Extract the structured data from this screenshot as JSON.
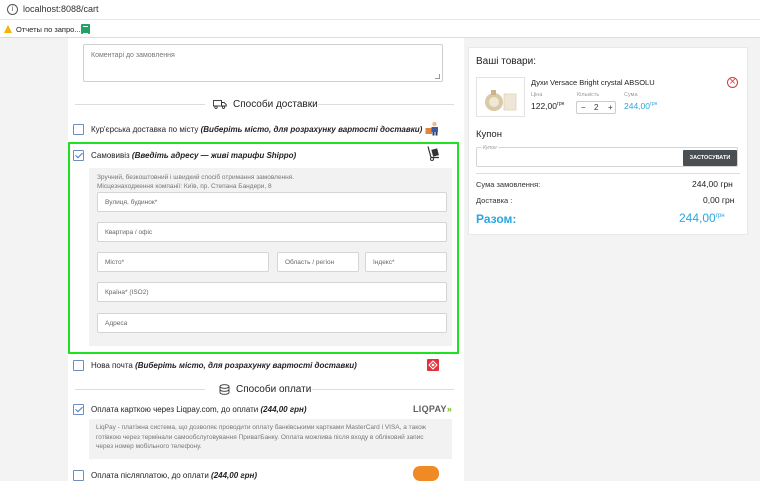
{
  "browser": {
    "url": "localhost:8088/cart",
    "bookmark1": "Отчеты по запро..."
  },
  "comment": {
    "placeholder": "Коментарі до замовлення"
  },
  "delivery": {
    "title": "Способи доставки",
    "courier_label": "Кур'єрська доставка по місту",
    "courier_hint": "(Виберіть місто, для розрахунку вартості доставки)",
    "pickup_label": "Самовивіз",
    "pickup_hint": "(Введіть адресу — живі тарифи Shippo)",
    "pickup_desc1": "Зручний, безкоштовний і швидкий спосіб отримання замовлення.",
    "pickup_desc2": "Місцезнаходження компанії: Київ, пр. Степана Бандери, 8",
    "fields": {
      "street": "Вулиця, будинок*",
      "apartment": "Квартира / офіс",
      "city": "Місто*",
      "region": "Область / регіон",
      "zip": "Індекс*",
      "country": "Країна* (ISO2)",
      "address": "Адреса"
    },
    "novaposhta_label": "Нова почта",
    "novaposhta_hint": "(Виберіть місто, для розрахунку вартості доставки)"
  },
  "payment": {
    "title": "Способи оплати",
    "liqpay_label": "Оплата карткою через Liqpay.com, до оплати",
    "liqpay_amount": "(244,00 грн)",
    "liqpay_logo": "LIQPAY",
    "liqpay_desc1": "LiqPay - платіжна система, що дозволяє проводити оплату банківськими картками MasterCard і VISA, а також",
    "liqpay_desc2": "готівкою через термінали самообслуговування ПриватБанку. Оплата можлива після входу в обліковий запис",
    "liqpay_desc3": "через номер мобільного телефону.",
    "cod_label": "Оплата післяплатою, до оплати",
    "cod_amount": "(244,00 грн)"
  },
  "cart": {
    "title": "Ваші товари:",
    "item_name": "Духи Versace Bright crystal ABSOLU",
    "price_label": "Ціна",
    "qty_label": "Кількість",
    "sum_label": "Сума",
    "price": "122,00",
    "currency": "грн",
    "qty": "2",
    "minus": "−",
    "plus": "+",
    "item_sum": "244,00",
    "coupon_title": "Купон",
    "coupon_placeholder": "Купон",
    "coupon_button": "ЗАСТОСУВАТИ",
    "order_sum_label": "Сума замовлення:",
    "order_sum": "244,00 грн",
    "delivery_label": "Доставка :",
    "delivery_value": "0,00 грн",
    "total_label": "Разом:",
    "total": "244,00",
    "total_currency": "грн"
  },
  "colors": {
    "accent": "#2aa7e0",
    "highlight": "#20e020",
    "danger": "#e0333b"
  }
}
